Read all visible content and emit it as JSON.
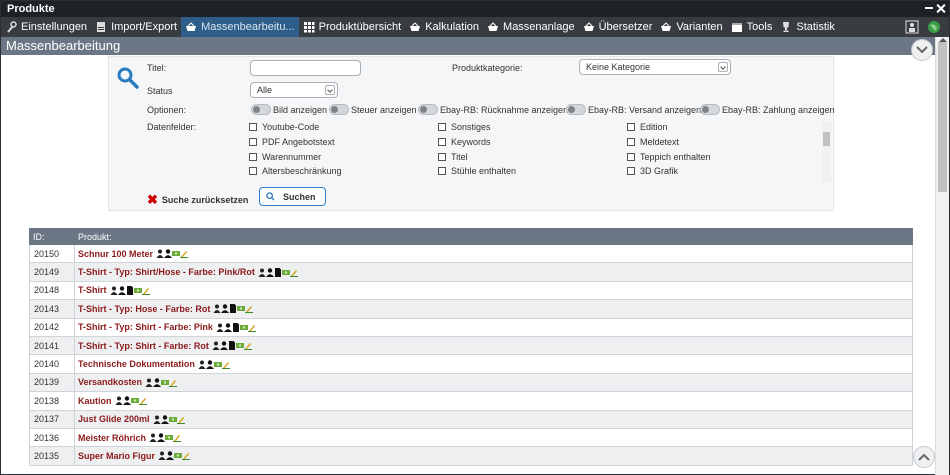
{
  "window": {
    "title": "Produkte"
  },
  "tabs": [
    {
      "label": "Einstellungen",
      "icon": "wrench-icon"
    },
    {
      "label": "Import/Export",
      "icon": "document-icon"
    },
    {
      "label": "Massenbearbeitu...",
      "icon": "basket-icon",
      "active": true
    },
    {
      "label": "Produktübersicht",
      "icon": "grid-icon"
    },
    {
      "label": "Kalkulation",
      "icon": "basket-icon"
    },
    {
      "label": "Massenanlage",
      "icon": "basket-icon"
    },
    {
      "label": "Übersetzer",
      "icon": "basket-icon"
    },
    {
      "label": "Varianten",
      "icon": "basket-icon"
    },
    {
      "label": "Tools",
      "icon": "calendar-icon"
    },
    {
      "label": "Statistik",
      "icon": "trophy-icon"
    }
  ],
  "header": {
    "title": "Massenbearbeitung"
  },
  "search": {
    "title_label": "Titel:",
    "title_value": "",
    "category_label": "Produktkategorie:",
    "category_value": "Keine Kategorie",
    "status_label": "Status",
    "status_value": "Alle",
    "options_label": "Optionen:",
    "options": [
      "Bild anzeigen",
      "Steuer anzeigen",
      "Ebay-RB: Rücknahme anzeigen",
      "Ebay-RB: Versand anzeigen",
      "Ebay-RB: Zahlung anzeigen"
    ],
    "datafields_label": "Datenfelder:",
    "datafields": [
      [
        "Youtube-Code",
        "Sonstiges",
        "Edition"
      ],
      [
        "PDF Angebotstext",
        "Keywords",
        "Meldetext"
      ],
      [
        "Warennummer",
        "Titel",
        "Teppich enthalten"
      ],
      [
        "Altersbeschränkung",
        "Stühle enthalten",
        "3D Grafik"
      ]
    ],
    "reset_label": "Suche zurücksetzen",
    "search_button": "Suchen"
  },
  "table": {
    "headers": [
      "ID:",
      "Produkt:"
    ],
    "rows": [
      {
        "id": "20150",
        "name": "Schnur 100 Meter",
        "icons": 4
      },
      {
        "id": "20149",
        "name": "T-Shirt - Typ: Shirt/Hose - Farbe: Pink/Rot",
        "icons": 5
      },
      {
        "id": "20148",
        "name": "T-Shirt",
        "icons": 5
      },
      {
        "id": "20143",
        "name": "T-Shirt - Typ: Hose - Farbe: Rot",
        "icons": 5
      },
      {
        "id": "20142",
        "name": "T-Shirt - Typ: Shirt - Farbe: Pink",
        "icons": 5
      },
      {
        "id": "20141",
        "name": "T-Shirt - Typ: Shirt - Farbe: Rot",
        "icons": 5
      },
      {
        "id": "20140",
        "name": "Technische Dokumentation",
        "icons": 4
      },
      {
        "id": "20139",
        "name": "Versandkosten",
        "icons": 4
      },
      {
        "id": "20138",
        "name": "Kaution",
        "icons": 4
      },
      {
        "id": "20137",
        "name": "Just Glide 200ml",
        "icons": 4
      },
      {
        "id": "20136",
        "name": "Meister Röhrich",
        "icons": 4
      },
      {
        "id": "20135",
        "name": "Super Mario Figur",
        "icons": 4
      }
    ]
  }
}
